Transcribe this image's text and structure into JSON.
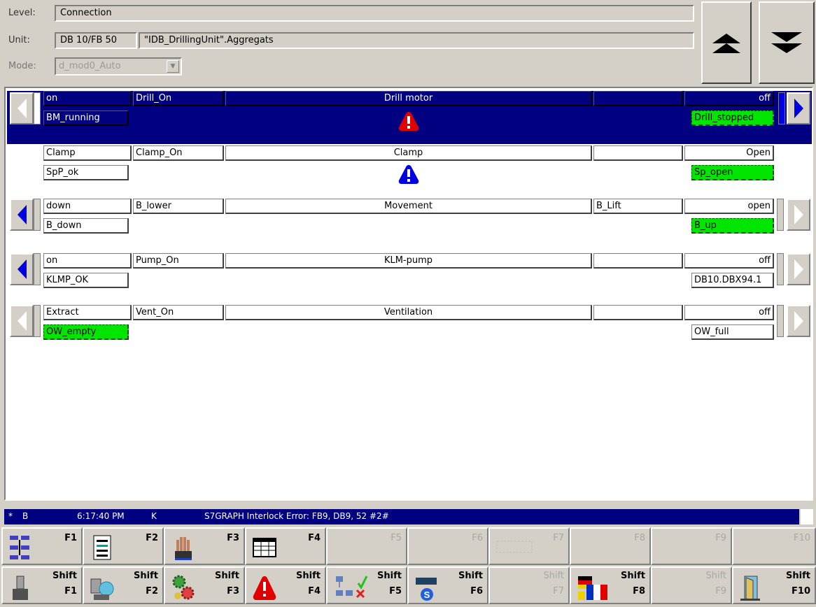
{
  "header": {
    "level_label": "Level:",
    "level_value": "Connection",
    "unit_label": "Unit:",
    "unit_db": "DB 10/FB 50",
    "unit_name": "\"IDB_DrillingUnit\".Aggregats",
    "mode_label": "Mode:",
    "mode_value": "d_mod0_Auto"
  },
  "rows": [
    {
      "c1": "on",
      "c2": "Drill_On",
      "c3": "Drill motor",
      "c4": "",
      "c5": "off",
      "sub_left": "BM_running",
      "sub_right": "Drill_stopped",
      "warn_color": "#e00000"
    },
    {
      "c1": "Clamp",
      "c2": "Clamp_On",
      "c3": "Clamp",
      "c4": "",
      "c5": "Open",
      "sub_left": "SpP_ok",
      "sub_right": "Sp_open",
      "warn_color": "#0000e0"
    },
    {
      "c1": "down",
      "c2": "B_lower",
      "c3": "Movement",
      "c4": "B_Lift",
      "c5": "open",
      "sub_left": "B_down",
      "sub_right": "B_up"
    },
    {
      "c1": "on",
      "c2": "Pump_On",
      "c3": "KLM-pump",
      "c4": "",
      "c5": "off",
      "sub_left": "KLMP_OK",
      "sub_right": "DB10.DBX94.1"
    },
    {
      "c1": "Extract",
      "c2": "Vent_On",
      "c3": "Ventilation",
      "c4": "",
      "c5": "off",
      "sub_left": "OW_empty",
      "sub_right": "OW_full"
    }
  ],
  "status": {
    "star": "*",
    "b": "B",
    "time": "6:17:40 PM",
    "k": "K",
    "message": "S7GRAPH Interlock Error:  FB9, DB9, 52  #2#"
  },
  "fkeys": [
    "F1",
    "F2",
    "F3",
    "F4",
    "F5",
    "F6",
    "F7",
    "F8",
    "F9",
    "F10"
  ],
  "shift_keys": [
    {
      "shift": "Shift",
      "key": "F1"
    },
    {
      "shift": "Shift",
      "key": "F2"
    },
    {
      "shift": "Shift",
      "key": "F3"
    },
    {
      "shift": "Shift",
      "key": "F4"
    },
    {
      "shift": "Shift",
      "key": "F5"
    },
    {
      "shift": "Shift",
      "key": "F6"
    },
    {
      "shift": "Shift",
      "key": "F7"
    },
    {
      "shift": "Shift",
      "key": "F8"
    },
    {
      "shift": "Shift",
      "key": "F9"
    },
    {
      "shift": "Shift",
      "key": "F10"
    }
  ],
  "colors": {
    "selection": "#000080",
    "ok_green": "#00e600",
    "nav_arrow": "#0000e0"
  }
}
